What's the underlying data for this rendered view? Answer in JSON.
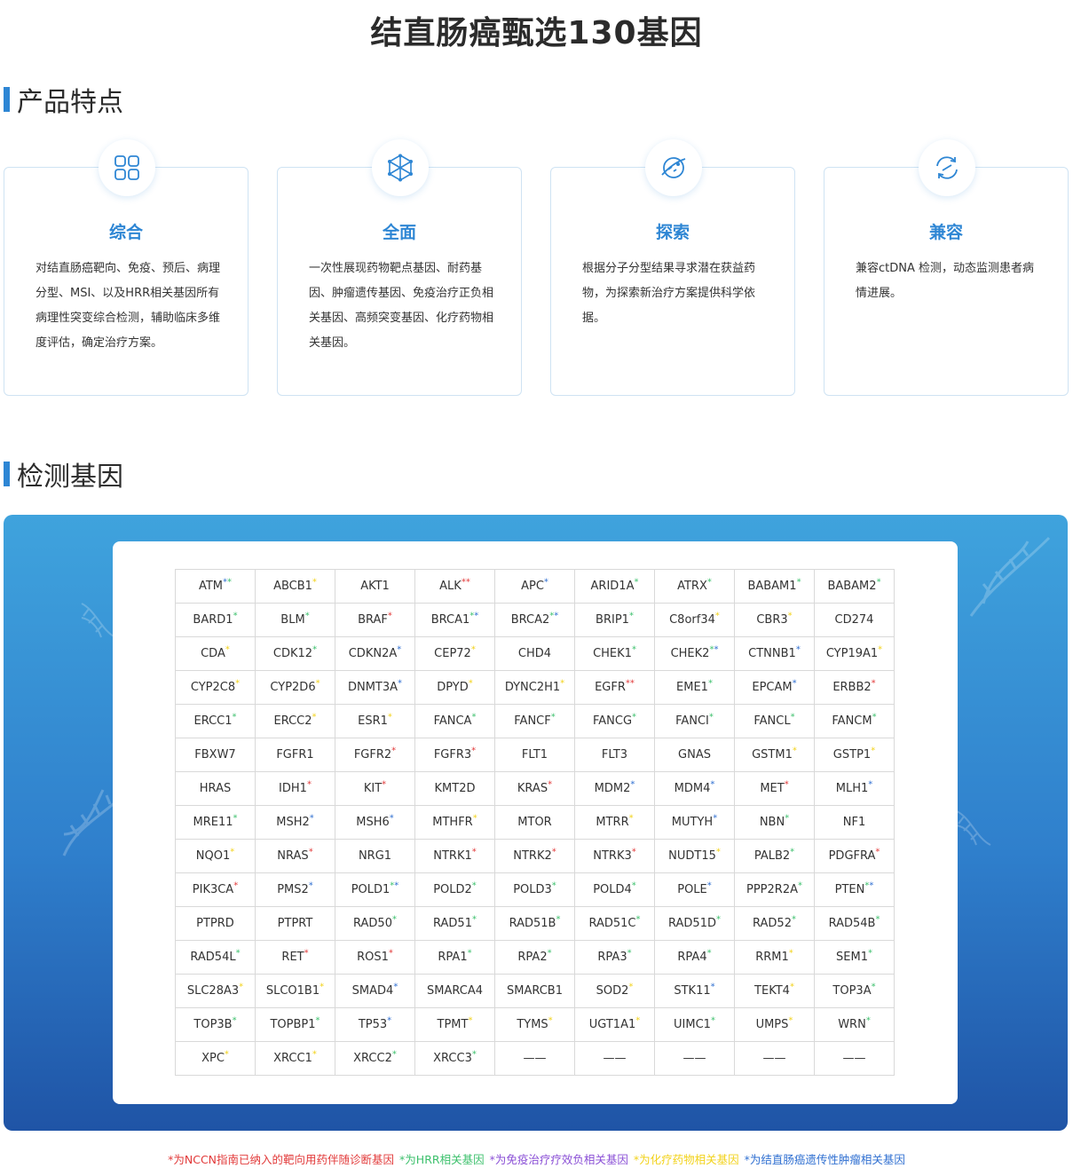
{
  "page_title": "结直肠癌甄选130基因",
  "section_features": {
    "title": "产品特点"
  },
  "section_genes": {
    "title": "检测基因"
  },
  "colors": {
    "accent": "#2e86d4",
    "red": "#e23a3a",
    "green": "#3cc06c",
    "purple": "#8a4fd6",
    "yellow": "#f2d21a",
    "blue": "#2f6fd1"
  },
  "cards": [
    {
      "icon": "grid-icon",
      "title": "综合",
      "body": "对结直肠癌靶向、免疫、预后、病理分型、MSI、以及HRR相关基因所有病理性突变综合检测，辅助临床多维度评估，确定治疗方案。"
    },
    {
      "icon": "molecule-icon",
      "title": "全面",
      "body": "一次性展现药物靶点基因、耐药基因、肿瘤遗传基因、免疫治疗正负相关基因、高频突变基因、化疗药物相关基因。"
    },
    {
      "icon": "planet-search-icon",
      "title": "探索",
      "body": "根据分子分型结果寻求潜在获益药物，为探索新治疗方案提供科学依据。"
    },
    {
      "icon": "sync-arrows-icon",
      "title": "兼容",
      "body": "兼容ctDNA 检测，动态监测患者病情进展。"
    }
  ],
  "genes": [
    [
      [
        "ATM",
        [
          "blue",
          "green"
        ]
      ],
      [
        "ABCB1",
        [
          "yellow"
        ]
      ],
      [
        "AKT1",
        []
      ],
      [
        "ALK",
        [
          "red",
          "red"
        ]
      ],
      [
        "APC",
        [
          "blue"
        ]
      ],
      [
        "ARID1A",
        [
          "green"
        ]
      ],
      [
        "ATRX",
        [
          "green"
        ]
      ],
      [
        "BABAM1",
        [
          "green"
        ]
      ],
      [
        "BABAM2",
        [
          "green"
        ]
      ]
    ],
    [
      [
        "BARD1",
        [
          "green"
        ]
      ],
      [
        "BLM",
        [
          "green"
        ]
      ],
      [
        "BRAF",
        [
          "red"
        ]
      ],
      [
        "BRCA1",
        [
          "green",
          "blue"
        ]
      ],
      [
        "BRCA2",
        [
          "green",
          "blue"
        ]
      ],
      [
        "BRIP1",
        [
          "green"
        ]
      ],
      [
        "C8orf34",
        [
          "yellow"
        ]
      ],
      [
        "CBR3",
        [
          "yellow"
        ]
      ],
      [
        "CD274",
        []
      ]
    ],
    [
      [
        "CDA",
        [
          "yellow"
        ]
      ],
      [
        "CDK12",
        [
          "green"
        ]
      ],
      [
        "CDKN2A",
        [
          "blue"
        ]
      ],
      [
        "CEP72",
        [
          "yellow"
        ]
      ],
      [
        "CHD4",
        []
      ],
      [
        "CHEK1",
        [
          "green"
        ]
      ],
      [
        "CHEK2",
        [
          "green",
          "blue"
        ]
      ],
      [
        "CTNNB1",
        [
          "blue"
        ]
      ],
      [
        "CYP19A1",
        [
          "yellow"
        ]
      ]
    ],
    [
      [
        "CYP2C8",
        [
          "yellow"
        ]
      ],
      [
        "CYP2D6",
        [
          "yellow"
        ]
      ],
      [
        "DNMT3A",
        [
          "blue"
        ]
      ],
      [
        "DPYD",
        [
          "yellow"
        ]
      ],
      [
        "DYNC2H1",
        [
          "yellow"
        ]
      ],
      [
        "EGFR",
        [
          "red",
          "red"
        ]
      ],
      [
        "EME1",
        [
          "green"
        ]
      ],
      [
        "EPCAM",
        [
          "blue"
        ]
      ],
      [
        "ERBB2",
        [
          "red"
        ]
      ]
    ],
    [
      [
        "ERCC1",
        [
          "green"
        ]
      ],
      [
        "ERCC2",
        [
          "yellow"
        ]
      ],
      [
        "ESR1",
        [
          "yellow"
        ]
      ],
      [
        "FANCA",
        [
          "green"
        ]
      ],
      [
        "FANCF",
        [
          "green"
        ]
      ],
      [
        "FANCG",
        [
          "green"
        ]
      ],
      [
        "FANCI",
        [
          "green"
        ]
      ],
      [
        "FANCL",
        [
          "green"
        ]
      ],
      [
        "FANCM",
        [
          "green"
        ]
      ]
    ],
    [
      [
        "FBXW7",
        []
      ],
      [
        "FGFR1",
        []
      ],
      [
        "FGFR2",
        [
          "red"
        ]
      ],
      [
        "FGFR3",
        [
          "red"
        ]
      ],
      [
        "FLT1",
        []
      ],
      [
        "FLT3",
        []
      ],
      [
        "GNAS",
        []
      ],
      [
        "GSTM1",
        [
          "yellow"
        ]
      ],
      [
        "GSTP1",
        [
          "yellow"
        ]
      ]
    ],
    [
      [
        "HRAS",
        []
      ],
      [
        "IDH1",
        [
          "red"
        ]
      ],
      [
        "KIT",
        [
          "red"
        ]
      ],
      [
        "KMT2D",
        []
      ],
      [
        "KRAS",
        [
          "red"
        ]
      ],
      [
        "MDM2",
        [
          "blue"
        ]
      ],
      [
        "MDM4",
        [
          "blue"
        ]
      ],
      [
        "MET",
        [
          "red"
        ]
      ],
      [
        "MLH1",
        [
          "blue"
        ]
      ]
    ],
    [
      [
        "MRE11",
        [
          "green"
        ]
      ],
      [
        "MSH2",
        [
          "blue"
        ]
      ],
      [
        "MSH6",
        [
          "blue"
        ]
      ],
      [
        "MTHFR",
        [
          "yellow"
        ]
      ],
      [
        "MTOR",
        []
      ],
      [
        "MTRR",
        [
          "yellow"
        ]
      ],
      [
        "MUTYH",
        [
          "blue"
        ]
      ],
      [
        "NBN",
        [
          "green"
        ]
      ],
      [
        "NF1",
        []
      ]
    ],
    [
      [
        "NQO1",
        [
          "yellow"
        ]
      ],
      [
        "NRAS",
        [
          "red"
        ]
      ],
      [
        "NRG1",
        []
      ],
      [
        "NTRK1",
        [
          "red"
        ]
      ],
      [
        "NTRK2",
        [
          "red"
        ]
      ],
      [
        "NTRK3",
        [
          "red"
        ]
      ],
      [
        "NUDT15",
        [
          "yellow"
        ]
      ],
      [
        "PALB2",
        [
          "green"
        ]
      ],
      [
        "PDGFRA",
        [
          "red"
        ]
      ]
    ],
    [
      [
        "PIK3CA",
        [
          "red"
        ]
      ],
      [
        "PMS2",
        [
          "blue"
        ]
      ],
      [
        "POLD1",
        [
          "green",
          "blue"
        ]
      ],
      [
        "POLD2",
        [
          "green"
        ]
      ],
      [
        "POLD3",
        [
          "green"
        ]
      ],
      [
        "POLD4",
        [
          "green"
        ]
      ],
      [
        "POLE",
        [
          "blue"
        ]
      ],
      [
        "PPP2R2A",
        [
          "green"
        ]
      ],
      [
        "PTEN",
        [
          "green",
          "blue"
        ]
      ]
    ],
    [
      [
        "PTPRD",
        []
      ],
      [
        "PTPRT",
        []
      ],
      [
        "RAD50",
        [
          "green"
        ]
      ],
      [
        "RAD51",
        [
          "green"
        ]
      ],
      [
        "RAD51B",
        [
          "green"
        ]
      ],
      [
        "RAD51C",
        [
          "green"
        ]
      ],
      [
        "RAD51D",
        [
          "green"
        ]
      ],
      [
        "RAD52",
        [
          "green"
        ]
      ],
      [
        "RAD54B",
        [
          "green"
        ]
      ]
    ],
    [
      [
        "RAD54L",
        [
          "green"
        ]
      ],
      [
        "RET",
        [
          "red"
        ]
      ],
      [
        "ROS1",
        [
          "red"
        ]
      ],
      [
        "RPA1",
        [
          "green"
        ]
      ],
      [
        "RPA2",
        [
          "green"
        ]
      ],
      [
        "RPA3",
        [
          "green"
        ]
      ],
      [
        "RPA4",
        [
          "green"
        ]
      ],
      [
        "RRM1",
        [
          "yellow"
        ]
      ],
      [
        "SEM1",
        [
          "green"
        ]
      ]
    ],
    [
      [
        "SLC28A3",
        [
          "yellow"
        ]
      ],
      [
        "SLCO1B1",
        [
          "yellow"
        ]
      ],
      [
        "SMAD4",
        [
          "blue"
        ]
      ],
      [
        "SMARCA4",
        []
      ],
      [
        "SMARCB1",
        []
      ],
      [
        "SOD2",
        [
          "yellow"
        ]
      ],
      [
        "STK11",
        [
          "blue"
        ]
      ],
      [
        "TEKT4",
        [
          "yellow"
        ]
      ],
      [
        "TOP3A",
        [
          "green"
        ]
      ]
    ],
    [
      [
        "TOP3B",
        [
          "green"
        ]
      ],
      [
        "TOPBP1",
        [
          "green"
        ]
      ],
      [
        "TP53",
        [
          "blue"
        ]
      ],
      [
        "TPMT",
        [
          "yellow"
        ]
      ],
      [
        "TYMS",
        [
          "yellow"
        ]
      ],
      [
        "UGT1A1",
        [
          "yellow"
        ]
      ],
      [
        "UIMC1",
        [
          "green"
        ]
      ],
      [
        "UMPS",
        [
          "yellow"
        ]
      ],
      [
        "WRN",
        [
          "green"
        ]
      ]
    ],
    [
      [
        "XPC",
        [
          "yellow"
        ]
      ],
      [
        "XRCC1",
        [
          "yellow"
        ]
      ],
      [
        "XRCC2",
        [
          "green"
        ]
      ],
      [
        "XRCC3",
        [
          "green"
        ]
      ],
      [
        "——",
        []
      ],
      [
        "——",
        []
      ],
      [
        "——",
        []
      ],
      [
        "——",
        []
      ],
      [
        "——",
        []
      ]
    ]
  ],
  "legend": [
    {
      "color": "red",
      "text": "*为NCCN指南已纳入的靶向用药伴随诊断基因"
    },
    {
      "color": "green",
      "text": "*为HRR相关基因"
    },
    {
      "color": "purple",
      "text": "*为免疫治疗疗效负相关基因"
    },
    {
      "color": "yellow",
      "text": "*为化疗药物相关基因"
    },
    {
      "color": "blue",
      "text": "*为结直肠癌遗传性肿瘤相关基因"
    }
  ]
}
